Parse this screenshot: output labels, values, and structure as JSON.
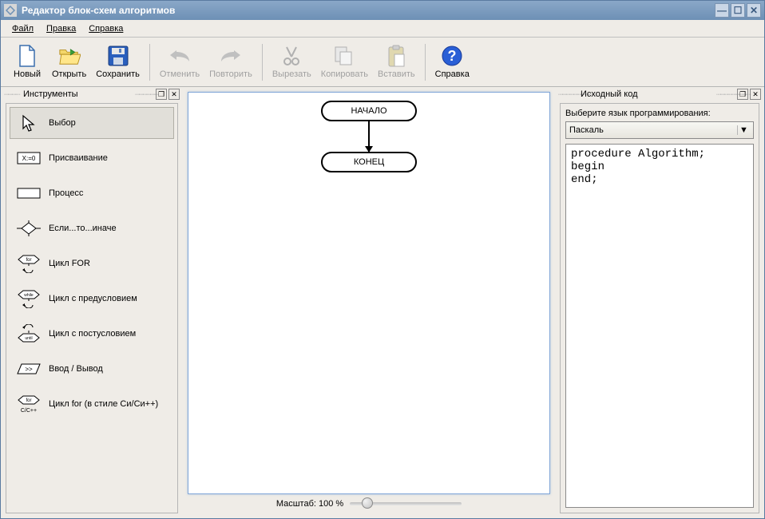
{
  "window": {
    "title": "Редактор блок-схем алгоритмов"
  },
  "menu": {
    "file": "Файл",
    "edit": "Правка",
    "help": "Справка"
  },
  "toolbar": {
    "new": "Новый",
    "open": "Открыть",
    "save": "Сохранить",
    "undo": "Отменить",
    "redo": "Повторить",
    "cut": "Вырезать",
    "copy": "Копировать",
    "paste": "Вставить",
    "help": "Справка"
  },
  "panels": {
    "tools_title": "Инструменты",
    "source_title": "Исходный код"
  },
  "tools": {
    "select": "Выбор",
    "assign": "Присваивание",
    "process": "Процесс",
    "if": "Если...то...иначе",
    "for": "Цикл FOR",
    "while": "Цикл с предусловием",
    "until": "Цикл с постусловием",
    "io": "Ввод / Вывод",
    "cfor": "Цикл for (в стиле Си/Си++)"
  },
  "canvas": {
    "start": "НАЧАЛО",
    "end": "КОНЕЦ"
  },
  "zoom": {
    "label": "Масштаб: 100 %"
  },
  "source": {
    "lang_label": "Выберите язык программирования:",
    "lang_selected": "Паскаль",
    "code": "procedure Algorithm;\nbegin\nend;"
  }
}
